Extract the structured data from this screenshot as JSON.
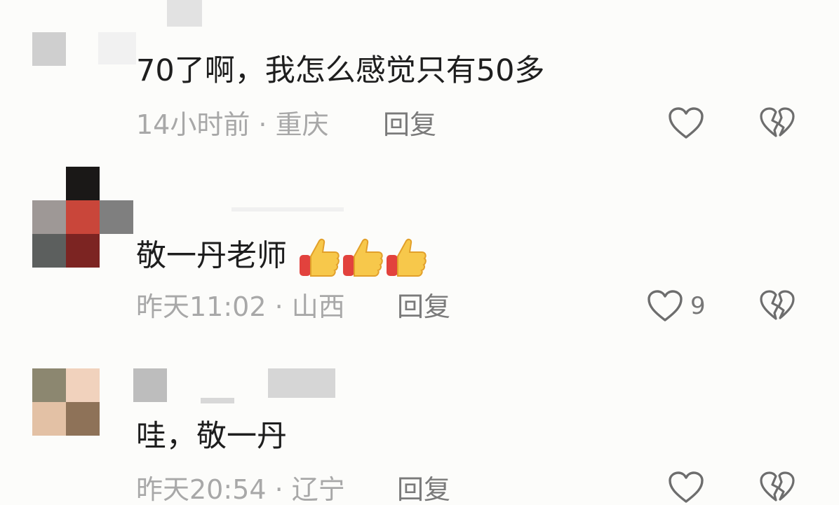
{
  "comments": [
    {
      "text": "70了啊，我怎么感觉只有50多",
      "meta": "14小时前 · 重庆",
      "reply_label": "回复",
      "like_count": "",
      "avatar_colors": [
        "#c8c8c8",
        "#e8e8e8",
        "#f4f4f4",
        "#f8f8f8"
      ],
      "like_icon": "heart-outline-icon",
      "dislike_icon": "broken-heart-icon"
    },
    {
      "text": "敬一丹老师",
      "emoji_count": 3,
      "emoji_icon": "thumbs-up-emoji",
      "meta": "昨天11:02 · 山西",
      "reply_label": "回复",
      "like_count": "9",
      "avatar_colors": [
        "#9e9896",
        "#c9463a",
        "#5c5f5e",
        "#7c2422"
      ],
      "like_icon": "heart-outline-icon",
      "dislike_icon": "broken-heart-icon"
    },
    {
      "text": "哇，敬一丹",
      "meta": "昨天20:54 · 辽宁",
      "reply_label": "回复",
      "like_count": "",
      "avatar_colors": [
        "#8c8770",
        "#f1d2bd",
        "#e3c1a5",
        "#8e7258"
      ],
      "like_icon": "heart-outline-icon",
      "dislike_icon": "broken-heart-icon"
    }
  ]
}
